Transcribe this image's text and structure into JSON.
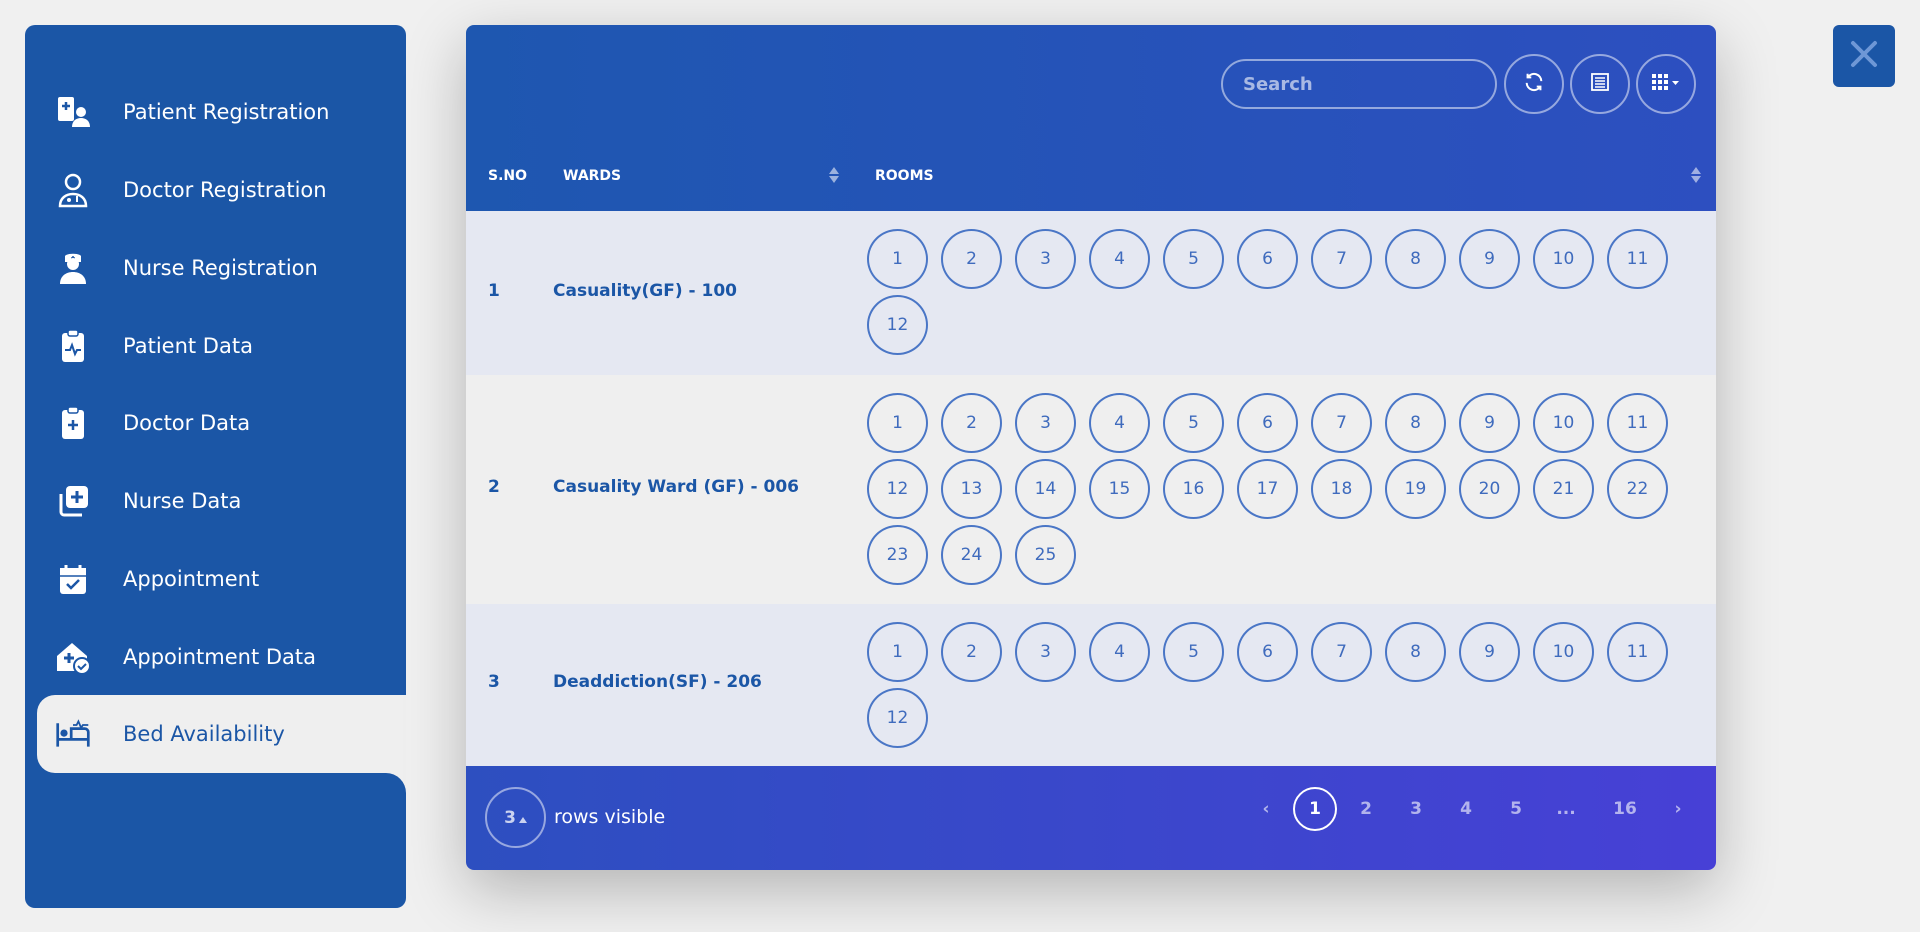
{
  "sidebar": {
    "items": [
      {
        "label": "Patient Registration",
        "icon": "patient-registration-icon"
      },
      {
        "label": "Doctor Registration",
        "icon": "doctor-icon"
      },
      {
        "label": "Nurse Registration",
        "icon": "nurse-icon"
      },
      {
        "label": "Patient Data",
        "icon": "clipboard-pulse-icon"
      },
      {
        "label": "Doctor Data",
        "icon": "clipboard-plus-icon"
      },
      {
        "label": "Nurse Data",
        "icon": "medical-copy-icon"
      },
      {
        "label": "Appointment",
        "icon": "calendar-check-icon"
      },
      {
        "label": "Appointment Data",
        "icon": "house-medical-check-icon"
      },
      {
        "label": "Bed Availability",
        "icon": "bed-pulse-icon",
        "active": true
      }
    ]
  },
  "toolbar": {
    "search_placeholder": "Search",
    "refresh_icon": "refresh-icon",
    "toggle_view_icon": "list-icon",
    "columns_icon": "grid-icon"
  },
  "table": {
    "headers": {
      "sno": "S.NO",
      "wards": "WARDS",
      "rooms": "ROOMS"
    },
    "rows": [
      {
        "sno": "1",
        "ward": "Casuality(GF) - 100",
        "rooms": [
          "1",
          "2",
          "3",
          "4",
          "5",
          "6",
          "7",
          "8",
          "9",
          "10",
          "11",
          "12"
        ]
      },
      {
        "sno": "2",
        "ward": "Casuality Ward (GF) - 006",
        "rooms": [
          "1",
          "2",
          "3",
          "4",
          "5",
          "6",
          "7",
          "8",
          "9",
          "10",
          "11",
          "12",
          "13",
          "14",
          "15",
          "16",
          "17",
          "18",
          "19",
          "20",
          "21",
          "22",
          "23",
          "24",
          "25"
        ]
      },
      {
        "sno": "3",
        "ward": "Deaddiction(SF) - 206",
        "rooms": [
          "1",
          "2",
          "3",
          "4",
          "5",
          "6",
          "7",
          "8",
          "9",
          "10",
          "11",
          "12"
        ]
      }
    ]
  },
  "footer": {
    "rows_count": "3",
    "rows_label": "rows visible",
    "pages": [
      "1",
      "2",
      "3",
      "4",
      "5",
      "...",
      "16"
    ],
    "current_page": "1",
    "prev": "‹",
    "next": "›"
  },
  "colors": {
    "primary": "#1b56a6",
    "header_gradient_end": "#2d4fc0",
    "footer_gradient_end": "#4740d6"
  }
}
